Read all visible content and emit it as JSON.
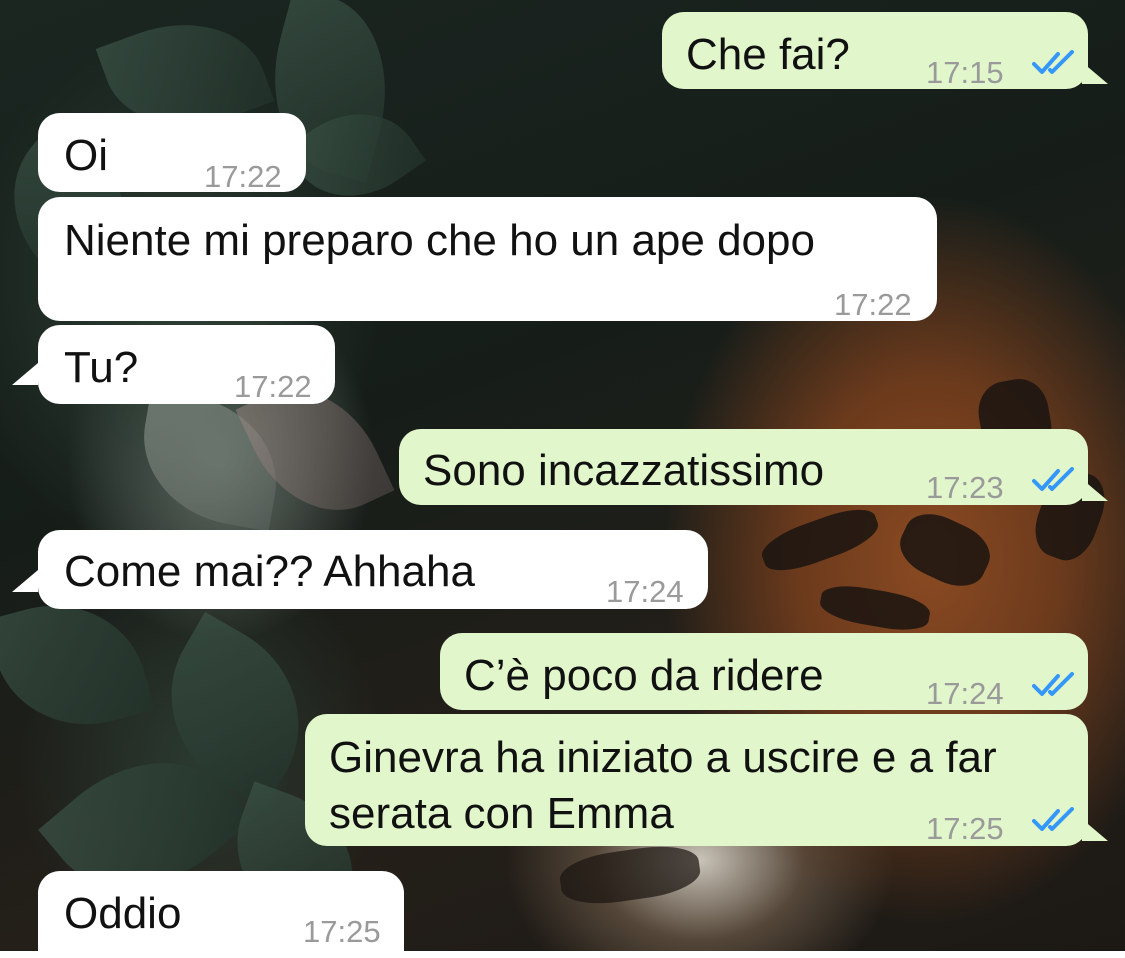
{
  "messages": [
    {
      "direction": "outgoing",
      "text": "Che fai?",
      "time": "17:15",
      "status": "read-double-check-icon"
    },
    {
      "direction": "incoming",
      "text": "Oi",
      "time": "17:22"
    },
    {
      "direction": "incoming",
      "text": "Niente mi preparo che ho un ape dopo",
      "time": "17:22"
    },
    {
      "direction": "incoming",
      "text": "Tu?",
      "time": "17:22"
    },
    {
      "direction": "outgoing",
      "text": "Sono incazzatissimo",
      "time": "17:23",
      "status": "read-double-check-icon"
    },
    {
      "direction": "incoming",
      "text": "Come mai?? Ahhaha",
      "time": "17:24"
    },
    {
      "direction": "outgoing",
      "text": "C’è poco da ridere",
      "time": "17:24",
      "status": "read-double-check-icon"
    },
    {
      "direction": "outgoing",
      "text_line1": "Ginevra ha iniziato a uscire e a far",
      "text_line2": "serata con Emma",
      "time": "17:25",
      "status": "read-double-check-icon"
    },
    {
      "direction": "incoming",
      "text": "Oddio",
      "time": "17:25"
    }
  ],
  "colors": {
    "outgoing_bubble": "#e1f7cb",
    "incoming_bubble": "#ffffff",
    "timestamp": "#9a9a9a",
    "read_ticks": "#3497f9"
  },
  "wallpaper": "tiger-jungle-wallpaper"
}
